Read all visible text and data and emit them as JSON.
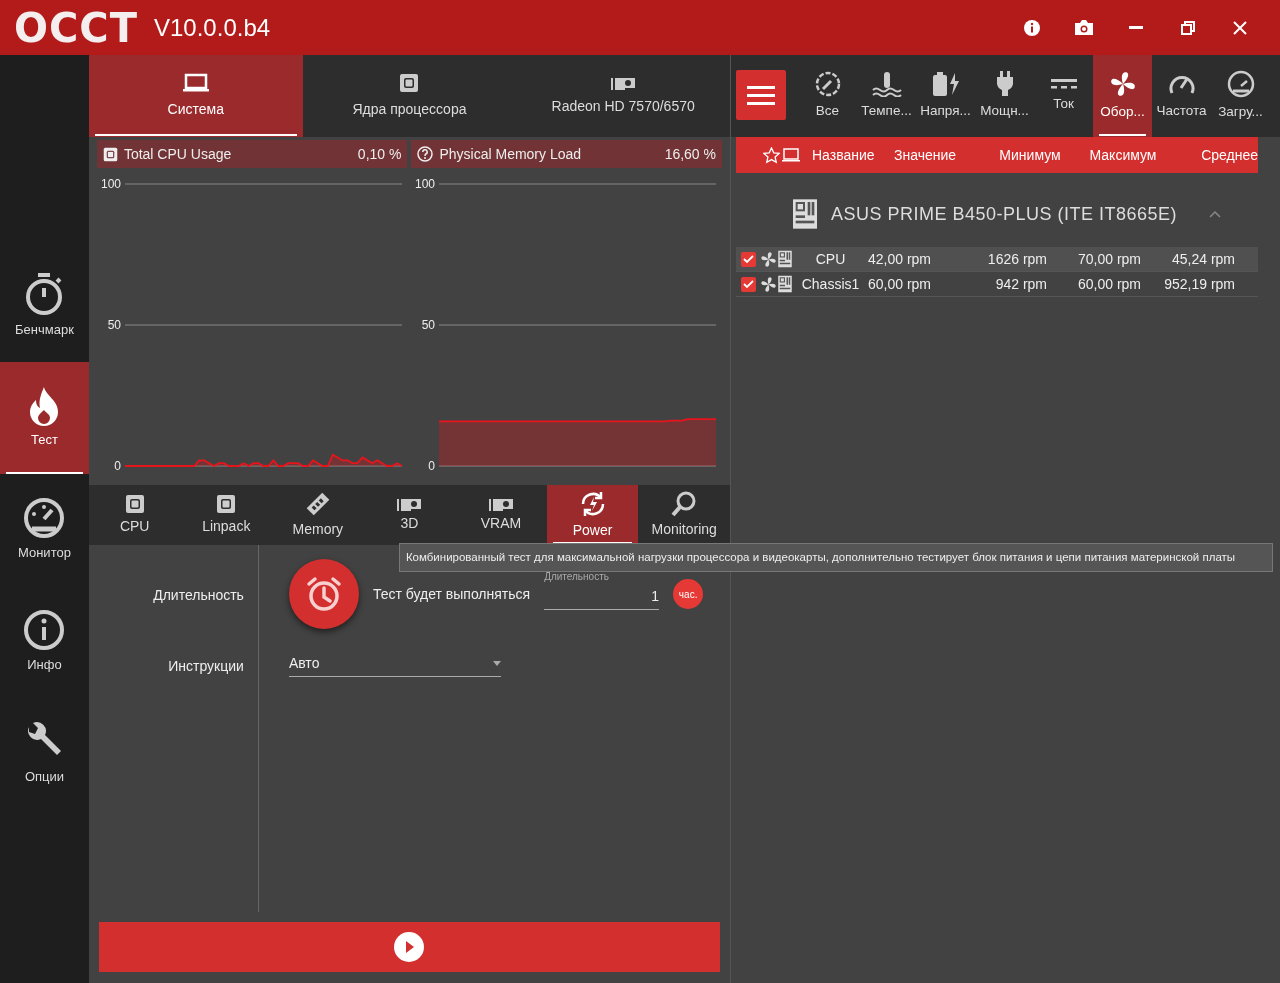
{
  "window": {
    "logo": "OCCT",
    "version": "V10.0.0.b4"
  },
  "sidebar": {
    "items": [
      {
        "label": "Бенчмарк",
        "selected": false
      },
      {
        "label": "Тест",
        "selected": true
      },
      {
        "label": "Монитор",
        "selected": false
      },
      {
        "label": "Инфо",
        "selected": false
      },
      {
        "label": "Опции",
        "selected": false
      }
    ]
  },
  "device_tabs": [
    {
      "label": "Система",
      "selected": true
    },
    {
      "label": "Ядра процессора",
      "selected": false
    },
    {
      "label": "Radeon HD 7570/6570",
      "selected": false
    }
  ],
  "graphs": [
    {
      "title": "Total CPU Usage",
      "value": "0,10 %",
      "chart_data": {
        "type": "area",
        "ylim": [
          0,
          100
        ],
        "yticks": [
          0,
          50,
          100
        ],
        "series": [
          {
            "color": "#e8141c",
            "values": [
              0,
              0,
              0,
              0,
              0,
              0,
              0,
              0,
              0,
              0,
              0,
              0,
              0,
              0,
              0,
              2,
              2,
              1,
              0,
              1,
              1,
              0,
              0,
              0,
              1,
              0,
              1,
              1,
              0,
              0,
              2,
              0,
              0,
              1,
              1,
              1,
              0,
              0,
              2,
              1,
              0,
              0,
              4,
              3,
              2,
              2,
              1,
              1,
              3,
              2,
              1,
              2,
              1,
              0,
              0,
              1,
              0
            ]
          }
        ]
      }
    },
    {
      "title": "Physical Memory Load",
      "value": "16,60 %",
      "chart_data": {
        "type": "area",
        "ylim": [
          0,
          100
        ],
        "yticks": [
          0,
          50,
          100
        ],
        "series": [
          {
            "color": "#e8141c",
            "values": [
              15.8,
              15.8,
              15.8,
              15.8,
              15.8,
              15.8,
              15.8,
              15.8,
              15.8,
              15.8,
              15.8,
              15.8,
              15.8,
              15.8,
              15.8,
              15.8,
              15.8,
              15.8,
              15.8,
              15.8,
              15.8,
              15.8,
              15.8,
              15.8,
              15.8,
              15.8,
              15.8,
              15.8,
              15.8,
              15.8,
              15.8,
              15.8,
              15.8,
              15.8,
              15.8,
              15.8,
              15.8,
              15.8,
              15.8,
              15.8,
              15.8,
              16.1,
              16.1,
              16.1,
              16.6,
              16.6,
              16.6,
              16.6,
              16.6,
              16.6
            ]
          }
        ]
      }
    }
  ],
  "test_tabs": [
    {
      "label": "CPU",
      "selected": false
    },
    {
      "label": "Linpack",
      "selected": false
    },
    {
      "label": "Memory",
      "selected": false
    },
    {
      "label": "3D",
      "selected": false
    },
    {
      "label": "VRAM",
      "selected": false
    },
    {
      "label": "Power",
      "selected": true
    },
    {
      "label": "Monitoring",
      "selected": false
    }
  ],
  "tooltip": "Комбинированный тест для максимальной нагрузки процессора и видеокарты, дополнительно тестирует блок питания и цепи питания материнской платы",
  "form": {
    "duration_label": "Длительность",
    "duration_text": "Тест будет выполняться",
    "duration_field": {
      "label": "Длительность",
      "value": "1"
    },
    "unit": "час.",
    "instructions_label": "Инструкции",
    "instructions_value": "Авто"
  },
  "monitor_tabs": [
    {
      "label": "Все",
      "selected": false
    },
    {
      "label": "Темпе...",
      "selected": false
    },
    {
      "label": "Напря...",
      "selected": false
    },
    {
      "label": "Мощн...",
      "selected": false
    },
    {
      "label": "Ток",
      "selected": false
    },
    {
      "label": "Обор...",
      "selected": true
    },
    {
      "label": "Частота",
      "selected": false
    },
    {
      "label": "Загру...",
      "selected": false
    }
  ],
  "table": {
    "columns": [
      "Название",
      "Значение",
      "Минимум",
      "Максимум",
      "Среднее"
    ],
    "group": "ASUS PRIME B450-PLUS (ITE IT8665E)",
    "expanded": true,
    "rows": [
      {
        "checked": true,
        "cells": [
          "CPU",
          "42,00 rpm",
          "1626 rpm",
          "70,00 rpm",
          "45,24 rpm"
        ]
      },
      {
        "checked": true,
        "cells": [
          "Chassis1",
          "60,00 rpm",
          "942 rpm",
          "60,00 rpm",
          "952,19 rpm"
        ]
      }
    ]
  }
}
